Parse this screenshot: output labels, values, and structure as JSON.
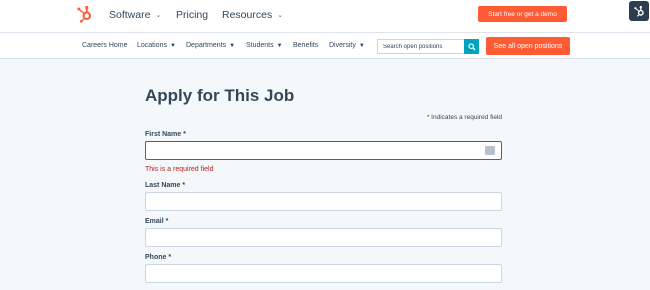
{
  "brand": {
    "logo_icon": "sprocket-logo-icon",
    "accent": "#ff5c35",
    "teal": "#00a4bd"
  },
  "top_nav": {
    "items": [
      {
        "label": "Software",
        "has_caret": true
      },
      {
        "label": "Pricing",
        "has_caret": false
      },
      {
        "label": "Resources",
        "has_caret": true
      }
    ],
    "cta_label": "Start free or get a demo"
  },
  "sub_nav": {
    "items": [
      {
        "label": "Careers Home",
        "has_caret": false
      },
      {
        "label": "Locations",
        "has_caret": true
      },
      {
        "label": "Departments",
        "has_caret": true
      },
      {
        "label": "Students",
        "has_caret": true
      },
      {
        "label": "Benefits",
        "has_caret": false
      },
      {
        "label": "Diversity",
        "has_caret": true
      }
    ],
    "search_placeholder": "Search open positions",
    "cta_label": "See all open positions"
  },
  "form": {
    "title": "Apply for This Job",
    "required_note": "* Indicates a required field",
    "fields": [
      {
        "label": "First Name *",
        "value": "",
        "error": "This is a required field"
      },
      {
        "label": "Last Name *",
        "value": ""
      },
      {
        "label": "Email *",
        "value": ""
      },
      {
        "label": "Phone *",
        "value": ""
      }
    ]
  }
}
